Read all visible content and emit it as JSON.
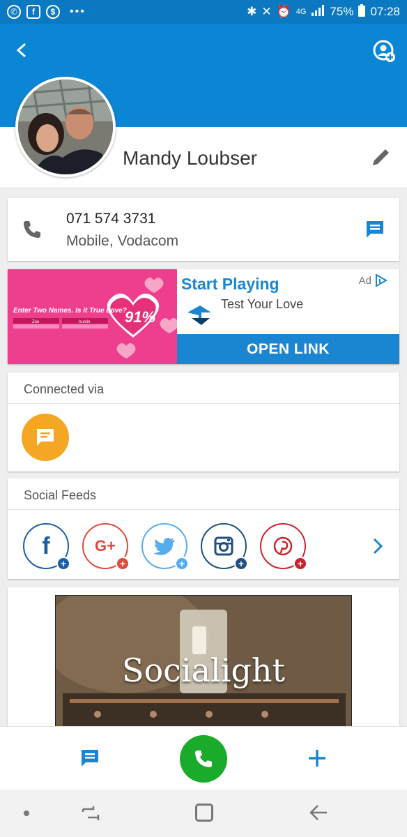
{
  "status_bar": {
    "battery": "75%",
    "time": "07:28",
    "network": "4G"
  },
  "contact": {
    "name": "Mandy Loubser"
  },
  "phone": {
    "number": "071 574 3731",
    "type": "Mobile, Vodacom"
  },
  "ad": {
    "title": "Start Playing",
    "badge": "Ad",
    "subtitle": "Test Your Love",
    "cta": "OPEN LINK",
    "image_question": "Enter Two Names. Is it True Love?",
    "image_name_1": "Zoe",
    "image_name_2": "Austin",
    "image_percent": "91%"
  },
  "connected": {
    "title": "Connected via"
  },
  "social": {
    "title": "Social Feeds",
    "items": [
      {
        "name": "facebook",
        "glyph": "f",
        "color": "#1a5ea8"
      },
      {
        "name": "google-plus",
        "glyph": "G+",
        "color": "#dd4b39"
      },
      {
        "name": "twitter",
        "glyph": "",
        "color": "#55acee"
      },
      {
        "name": "instagram",
        "glyph": "",
        "color": "#1d4f82"
      },
      {
        "name": "pinterest",
        "glyph": "",
        "color": "#c8232c"
      }
    ]
  },
  "socialight": {
    "brand": "Socialight"
  },
  "colors": {
    "header_blue": "#0b86d4",
    "status_blue": "#0b78c2",
    "accent_blue": "#1a85d0",
    "call_green": "#1aab2a",
    "connected_orange": "#f5a623"
  }
}
